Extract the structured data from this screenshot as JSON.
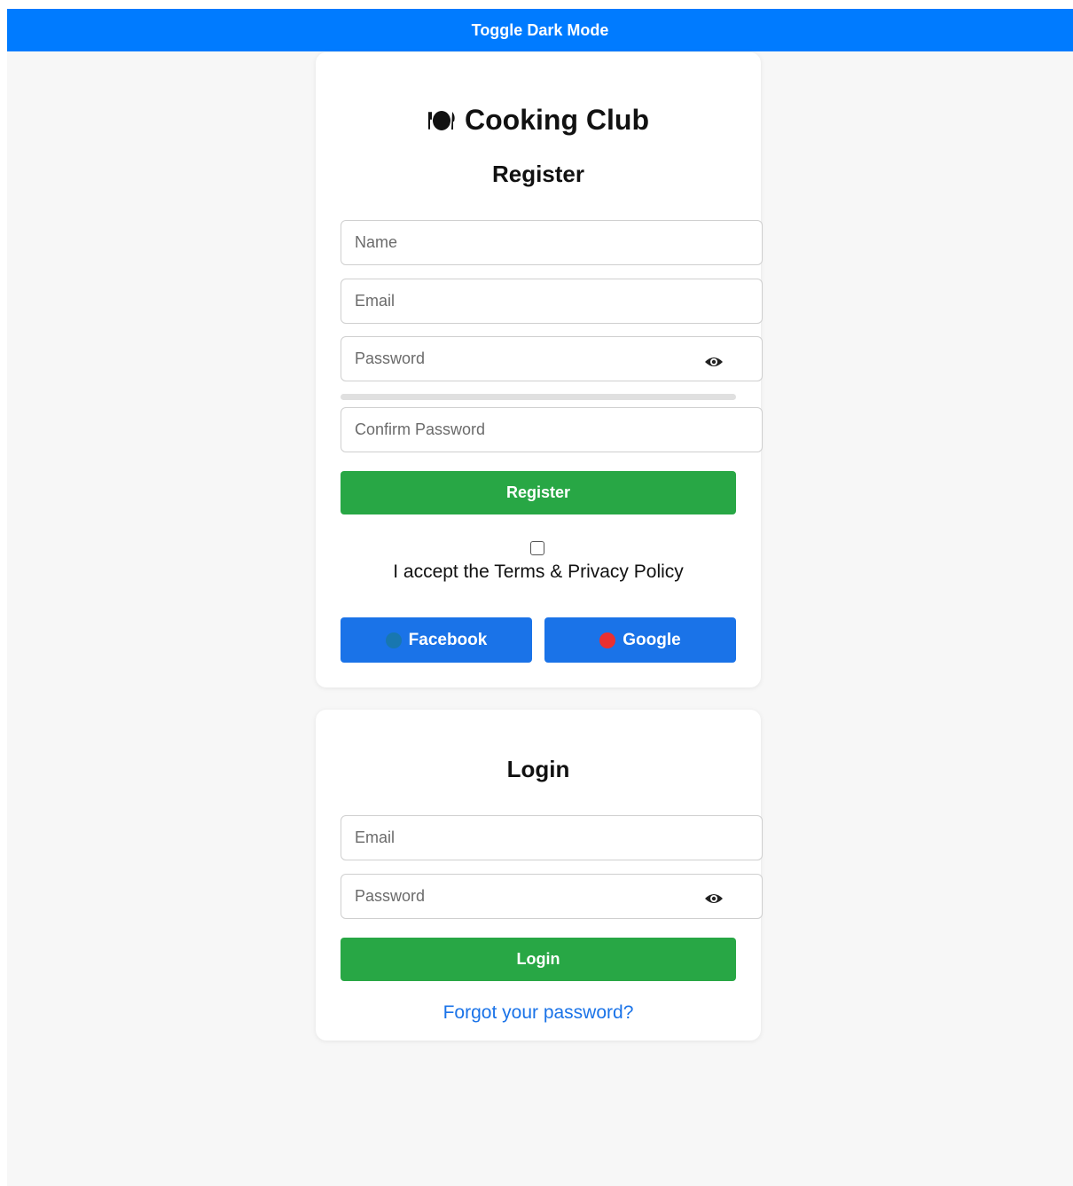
{
  "toggle": {
    "label": "Toggle Dark Mode"
  },
  "register": {
    "brand": "Cooking Club",
    "brand_icon": "plate-cutlery-icon",
    "heading": "Register",
    "name_placeholder": "Name",
    "email_placeholder": "Email",
    "password_placeholder": "Password",
    "confirm_placeholder": "Confirm Password",
    "password_strength_percent": 0,
    "submit_label": "Register",
    "terms_label": "I accept the Terms & Privacy Policy",
    "facebook_label": "Facebook",
    "google_label": "Google"
  },
  "login": {
    "heading": "Login",
    "email_placeholder": "Email",
    "password_placeholder": "Password",
    "submit_label": "Login",
    "forgot_label": "Forgot your password?"
  },
  "colors": {
    "toggle_bar": "#007bff",
    "primary_green": "#28a745",
    "social_blue": "#1a73e8",
    "facebook_dot": "#1877b0",
    "google_dot": "#ea3030",
    "link": "#1a73e8",
    "background": "#f7f7f7"
  }
}
